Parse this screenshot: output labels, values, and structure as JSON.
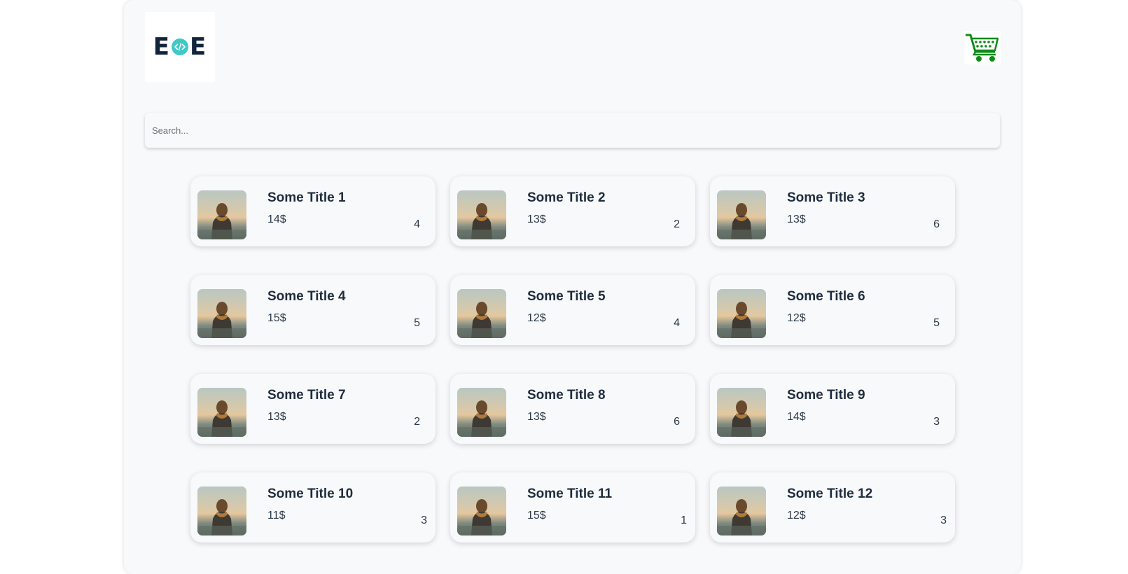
{
  "header": {
    "logo": {
      "left": "E",
      "right": "E",
      "center_icon": "code-icon"
    },
    "cart_icon": "shopping-cart-icon",
    "cart_color": "#0f8a1a"
  },
  "search": {
    "placeholder": "Search...",
    "value": ""
  },
  "products": [
    {
      "title": "Some Title 1",
      "price": "14$",
      "qty": "4"
    },
    {
      "title": "Some Title 2",
      "price": "13$",
      "qty": "2"
    },
    {
      "title": "Some Title 3",
      "price": "13$",
      "qty": "6"
    },
    {
      "title": "Some Title 4",
      "price": "15$",
      "qty": "5"
    },
    {
      "title": "Some Title 5",
      "price": "12$",
      "qty": "4"
    },
    {
      "title": "Some Title 6",
      "price": "12$",
      "qty": "5"
    },
    {
      "title": "Some Title 7",
      "price": "13$",
      "qty": "2"
    },
    {
      "title": "Some Title 8",
      "price": "13$",
      "qty": "6"
    },
    {
      "title": "Some Title 9",
      "price": "14$",
      "qty": "3"
    },
    {
      "title": "Some Title 10",
      "price": "11$",
      "qty": "3"
    },
    {
      "title": "Some Title 11",
      "price": "15$",
      "qty": "1"
    },
    {
      "title": "Some Title 12",
      "price": "12$",
      "qty": "3"
    }
  ]
}
